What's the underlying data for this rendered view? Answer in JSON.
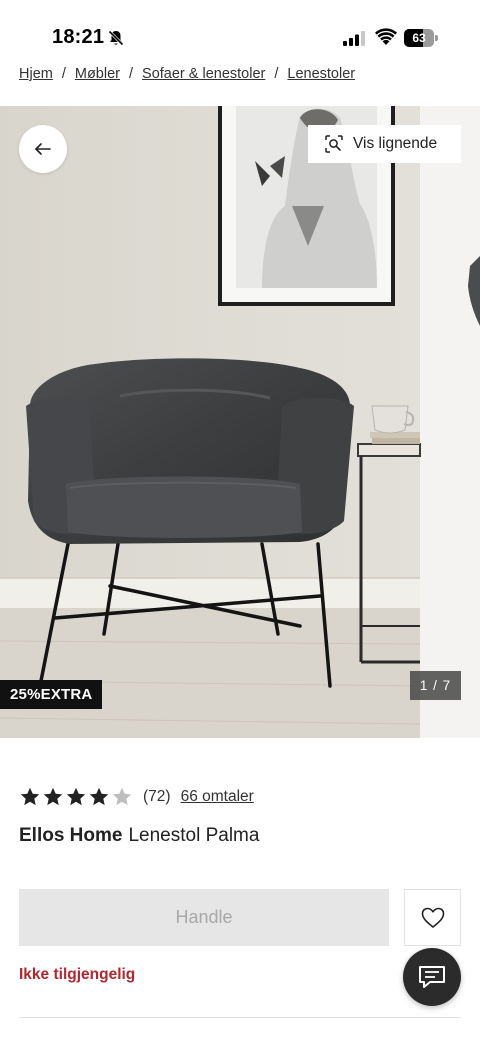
{
  "status_bar": {
    "time": "18:21",
    "battery": "63",
    "battery_level": 0.63
  },
  "breadcrumb": {
    "items": [
      "Hjem",
      "Møbler",
      "Sofaer & lenestoler",
      "Lenestoler"
    ],
    "separator": "/"
  },
  "gallery": {
    "vis_lignende_label": "Vis lignende",
    "promo_badge": "25%EXTRA",
    "page_counter": "1 / 7",
    "icons": {
      "back": "arrow-left-icon",
      "visual_search": "visual-search-icon"
    }
  },
  "rating": {
    "stars_value": 4,
    "stars_max": 5,
    "count": "(72)",
    "reviews_link": "66 omtaler",
    "star_color": "#222222",
    "empty_star_color": "#bdbdbd"
  },
  "product": {
    "brand": "Ellos Home",
    "name": "Lenestol Palma"
  },
  "actions": {
    "buy_label": "Handle",
    "availability": "Ikke tilgjengelig",
    "availability_color": "#b3262e",
    "wishlist_icon": "heart-icon",
    "chat_icon": "chat-icon"
  }
}
